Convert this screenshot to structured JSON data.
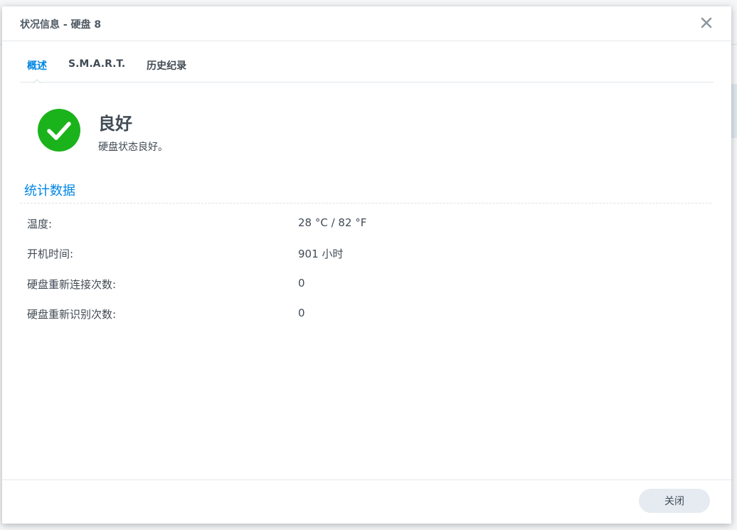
{
  "dialog": {
    "title": "状况信息 - 硬盘 8",
    "close_icon": "close-icon"
  },
  "tabs": [
    {
      "label": "概述",
      "active": true
    },
    {
      "label": "S.M.A.R.T.",
      "active": false
    },
    {
      "label": "历史纪录",
      "active": false
    }
  ],
  "status": {
    "icon": "check-circle-icon",
    "title": "良好",
    "description": "硬盘状态良好。"
  },
  "statistics": {
    "section_title": "统计数据",
    "rows": [
      {
        "label": "温度:",
        "value": "28 °C / 82 °F"
      },
      {
        "label": "开机时间:",
        "value": "901 小时"
      },
      {
        "label": "硬盘重新连接次数:",
        "value": "0"
      },
      {
        "label": "硬盘重新识别次数:",
        "value": "0"
      }
    ]
  },
  "footer": {
    "close_label": "关闭"
  },
  "colors": {
    "accent": "#0086e5",
    "success": "#1bb31b",
    "text": "#414b55"
  }
}
